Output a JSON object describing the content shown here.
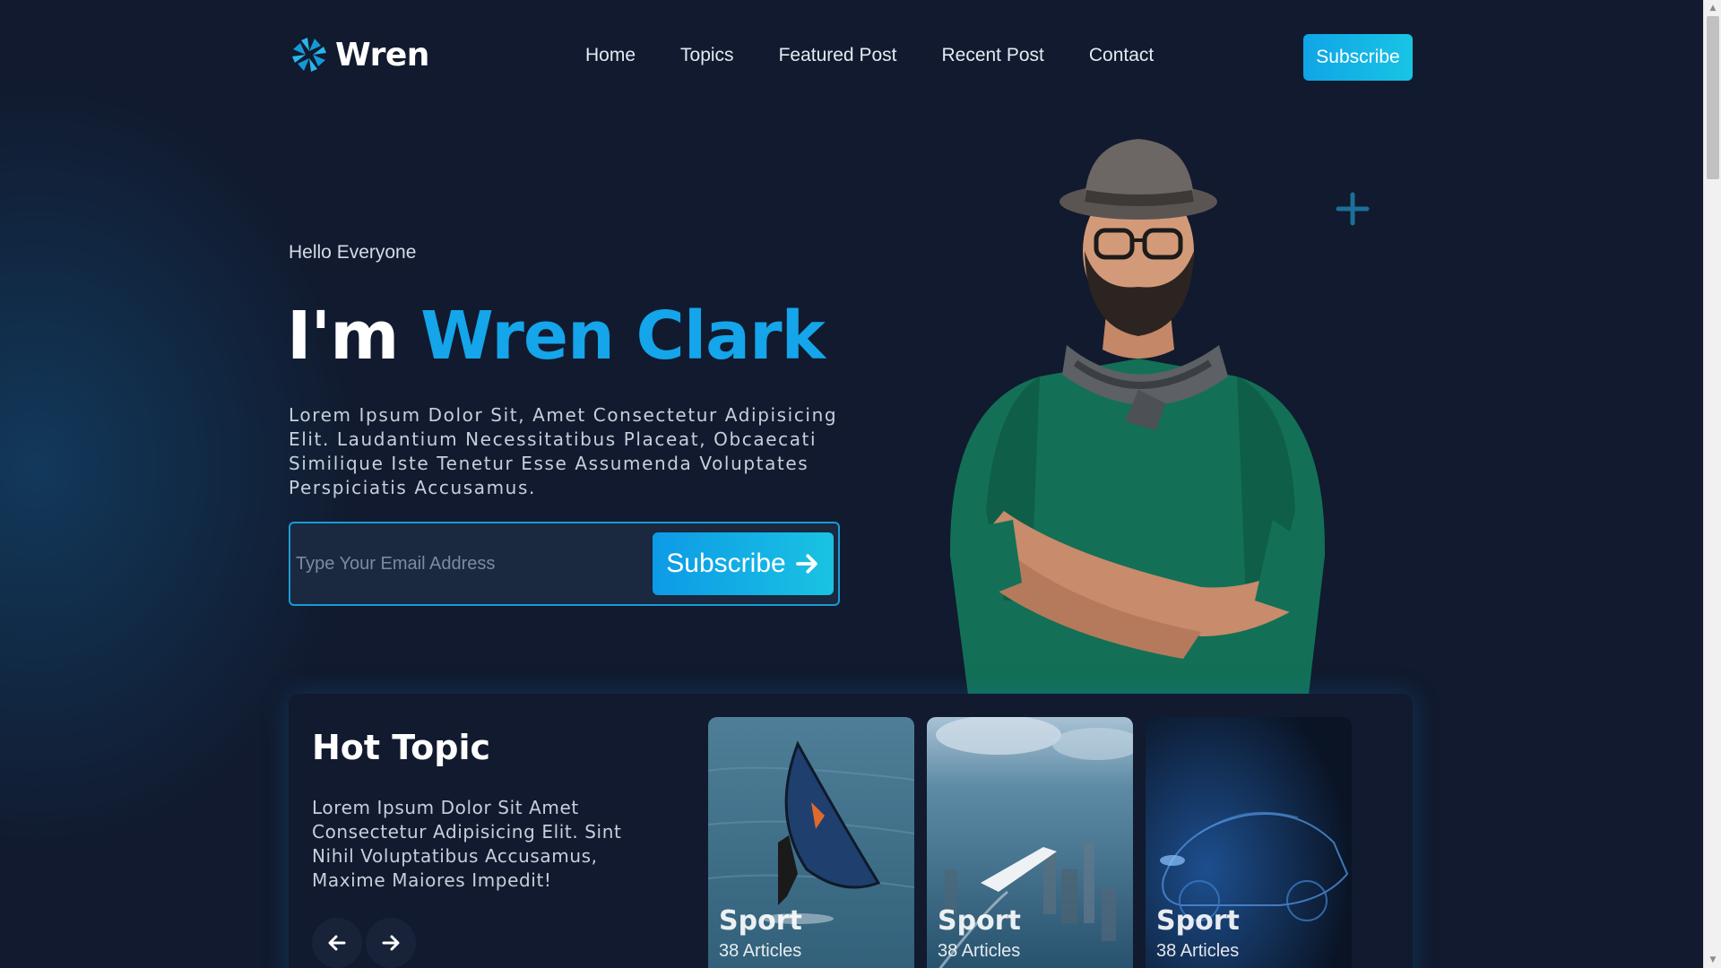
{
  "brand": {
    "name": "Wren"
  },
  "nav": {
    "items": [
      "Home",
      "Topics",
      "Featured Post",
      "Recent Post",
      "Contact"
    ],
    "subscribe_label": "Subscribe"
  },
  "hero": {
    "greeting": "Hello Everyone",
    "title_prefix": "I'm",
    "title_name": "Wren Clark",
    "description": "Lorem Ipsum Dolor Sit, Amet Consectetur Adipisicing Elit. Laudantium Necessitatibus Placeat, Obcaecati Similique Iste Tenetur Esse Assumenda Voluptates Perspiciatis Accusamus.",
    "email_placeholder": "Type Your Email Address",
    "subscribe_label": "Subscribe"
  },
  "hot_topic": {
    "title": "Hot Topic",
    "description": "Lorem Ipsum Dolor Sit Amet Consectetur Adipisicing Elit. Sint Nihil Voluptatibus Accusamus, Maxime Maiores Impedit!",
    "cards": [
      {
        "title": "Sport",
        "count": "38 Articles"
      },
      {
        "title": "Sport",
        "count": "38 Articles"
      },
      {
        "title": "Sport",
        "count": "38 Articles"
      }
    ]
  },
  "colors": {
    "background": "#111a2e",
    "accent": "#14a5ea",
    "button_gradient_start": "#10a5e6",
    "button_gradient_end": "#18c4e4"
  },
  "icons": [
    "logo-icon",
    "arrow-right-icon",
    "plus-icon",
    "arrow-left-icon",
    "scroll-up-icon",
    "scroll-down-icon"
  ]
}
